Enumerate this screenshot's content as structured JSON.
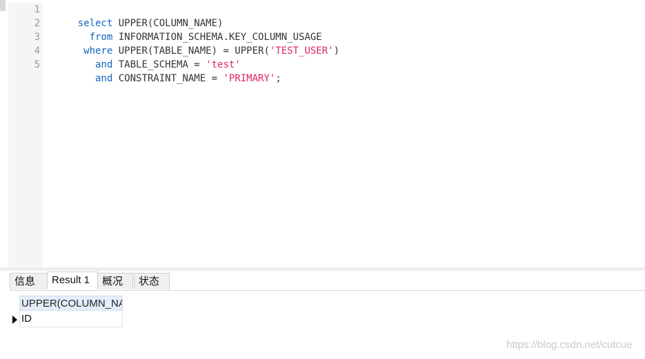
{
  "editor": {
    "line_numbers": [
      "1",
      "2",
      "3",
      "4",
      "5"
    ],
    "lines": [
      [
        {
          "t": "select",
          "k": "kw"
        },
        {
          "t": " UPPER(COLUMN_NAME)",
          "k": "plain"
        }
      ],
      [
        {
          "t": "  from",
          "k": "kw"
        },
        {
          "t": " INFORMATION_SCHEMA.KEY_COLUMN_USAGE",
          "k": "plain"
        }
      ],
      [
        {
          "t": " where",
          "k": "kw"
        },
        {
          "t": " UPPER(TABLE_NAME) = UPPER(",
          "k": "plain"
        },
        {
          "t": "'TEST_USER'",
          "k": "str"
        },
        {
          "t": ")",
          "k": "plain"
        }
      ],
      [
        {
          "t": "   and",
          "k": "kw"
        },
        {
          "t": " TABLE_SCHEMA = ",
          "k": "plain"
        },
        {
          "t": "'test'",
          "k": "str"
        }
      ],
      [
        {
          "t": "   and",
          "k": "kw"
        },
        {
          "t": " CONSTRAINT_NAME = ",
          "k": "plain"
        },
        {
          "t": "'PRIMARY'",
          "k": "str"
        },
        {
          "t": ";",
          "k": "plain"
        }
      ]
    ]
  },
  "tabs": [
    {
      "label": "信息"
    },
    {
      "label": "Result 1"
    },
    {
      "label": "概况"
    },
    {
      "label": "状态"
    }
  ],
  "result": {
    "column_header": "UPPER(COLUMN_NA",
    "rows": [
      "ID"
    ]
  },
  "watermark": "https://blog.csdn.net/cutcue",
  "colors": {
    "keyword": "#1565c0",
    "string": "#e0245e"
  }
}
